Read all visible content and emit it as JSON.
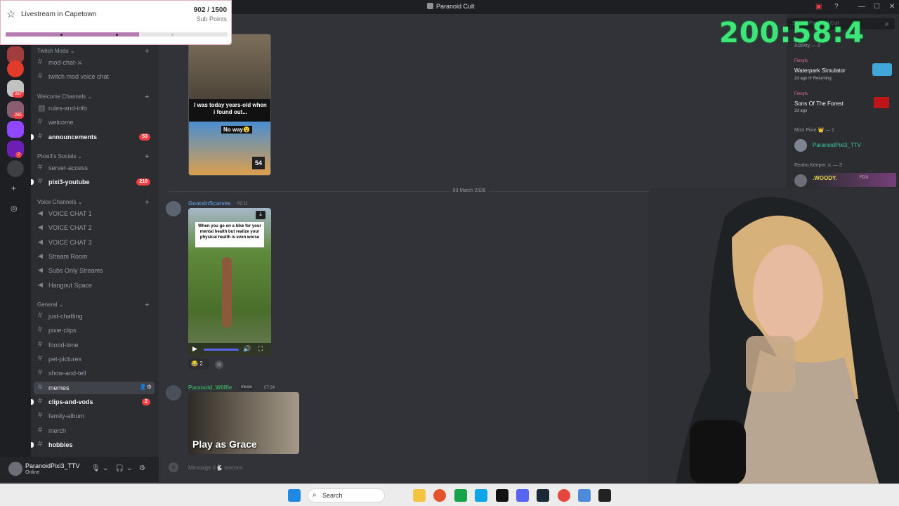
{
  "window": {
    "title": "Paranoid Cult"
  },
  "overlay": {
    "title": "Livestream in Capetown",
    "count": "902 / 1500",
    "label": "Sub Points",
    "progress": 0.602
  },
  "timer": "200:58:4",
  "rail": {
    "badges": [
      "267",
      "285",
      "2"
    ]
  },
  "sidebar": {
    "categories": {
      "twitch_mods": "Twitch Mods",
      "welcome": "Welcome Channels",
      "socials": "Pixie3's Socials",
      "voice": "Voice Channels",
      "general": "General"
    },
    "channels": {
      "mod_chat": "mod-chat-⚔",
      "twitch_mod_voice": "twitch mod voice chat",
      "rules": "rules-and-info",
      "welcome": "welcome",
      "announcements": "announcements",
      "announcements_badge": "53",
      "server_access": "server-access",
      "youtube": "pixi3-youtube",
      "youtube_badge": "210",
      "vc1": "VOICE CHAT 1",
      "vc2": "VOICE CHAT 2",
      "vc3": "VOICE CHAT 3",
      "stream_room": "Stream Room",
      "subs_only": "Subs Only Streams",
      "hangout": "Hangout Space",
      "just_chatting": "just-chatting",
      "pixie_clips": "pixie-clips",
      "foood_time": "foood-time",
      "pet_pictures": "pet-pictures",
      "show_and_tell": "show-and-tell",
      "memes": "memes",
      "clips_and_vods": "clips-and-vods",
      "clips_badge": "2",
      "family_album": "family-album",
      "merch": "merch",
      "hobbies": "hobbies"
    }
  },
  "user": {
    "name": "ParanoidPixi3_TTV",
    "status": "Online"
  },
  "chat": {
    "date": "03 March 2026",
    "msg1": {
      "author": "GoatsInScarves",
      "time": "02:11",
      "caption": "When you go on a hike for your mental health but realize your physical health is even worse"
    },
    "reaction_count": "2",
    "msg2": {
      "author": "Paranoid_W0lfie",
      "tag": "meow",
      "time": "07:24",
      "caption": "Play as Grace"
    },
    "meme1": {
      "caption_a": "I was today years-old when i found out...",
      "caption_b": "No way😮",
      "badge": "54"
    },
    "placeholder": "Message #🐇 memes"
  },
  "members": {
    "search_placeholder": "Search Paranoid Cult",
    "activity_header": "Activity — 2",
    "activity": [
      {
        "user": "Finnyls",
        "game": "Waterpark Simulator",
        "meta": "2d ago  ⟳ Returning"
      },
      {
        "user": "Finnyls",
        "game": "Sons Of The Forest",
        "meta": "2d ago"
      }
    ],
    "miss_pixie_header": "Miss Pixie 👑 — 1",
    "miss_pixie_member": "ParanoidPixi3_TTV",
    "realm_header": "Realm Keeper ⚔ — 3",
    "realm_member": ".WOODY.",
    "realm_tag": "FOX"
  },
  "taskbar": {
    "search": "Search"
  }
}
